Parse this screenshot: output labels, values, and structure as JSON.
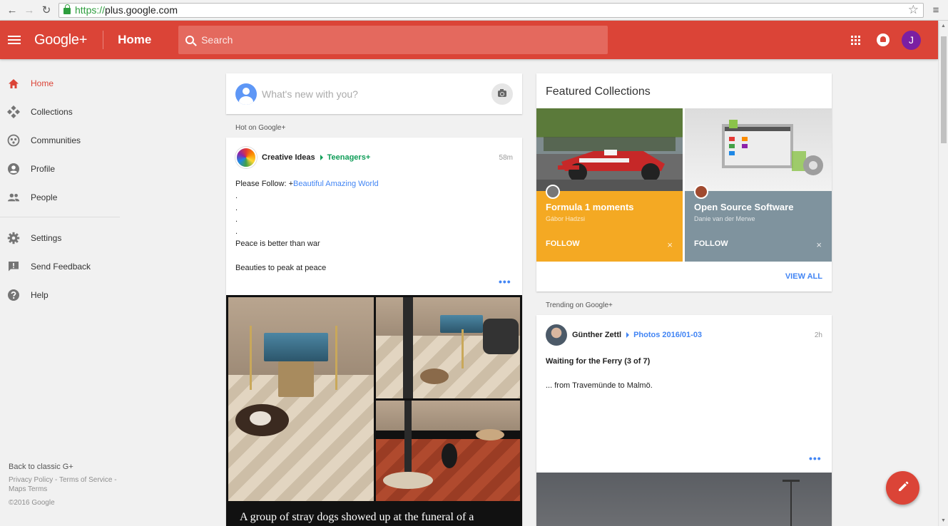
{
  "browser": {
    "url_protocol": "https://",
    "url_host": "plus.google.com",
    "icons": [
      "back-arrow-icon",
      "forward-arrow-icon",
      "reload-icon",
      "lock-icon",
      "star-icon",
      "menu-icon"
    ]
  },
  "appbar": {
    "brand": "Google+",
    "title": "Home",
    "search_placeholder": "Search",
    "avatar_letter": "J",
    "color": "#db4437"
  },
  "sidebar": {
    "items": [
      {
        "label": "Home",
        "icon": "home-icon",
        "active": true
      },
      {
        "label": "Collections",
        "icon": "collections-icon"
      },
      {
        "label": "Communities",
        "icon": "communities-icon"
      },
      {
        "label": "Profile",
        "icon": "profile-icon"
      },
      {
        "label": "People",
        "icon": "people-icon"
      },
      {
        "label": "Settings",
        "icon": "settings-icon"
      },
      {
        "label": "Send Feedback",
        "icon": "feedback-icon"
      },
      {
        "label": "Help",
        "icon": "help-icon"
      }
    ],
    "footer": {
      "back": "Back to classic G+",
      "privacy": "Privacy Policy",
      "terms": "Terms of Service",
      "maps_terms": "Maps Terms",
      "copyright": "©2016 Google"
    }
  },
  "composer": {
    "placeholder": "What's new with you?"
  },
  "hot": {
    "label": "Hot on Google+",
    "post": {
      "author": "Creative Ideas",
      "collection": "Teenagers+",
      "time": "58m",
      "line1_prefix": "Please Follow: +",
      "line1_link": "Beautiful Amazing World",
      "dot": ".",
      "line2": "Peace is better than war",
      "line3": "Beauties to peak at peace",
      "more": "•••",
      "image_caption": "A group of stray dogs showed up at the funeral of a"
    }
  },
  "featured": {
    "title": "Featured Collections",
    "collections": [
      {
        "name": "Formula 1 moments",
        "owner": "Gábor Hadzsi",
        "follow": "FOLLOW",
        "close": "×",
        "color": "#f4a923"
      },
      {
        "name": "Open Source Software",
        "owner": "Danie van der Merwe",
        "follow": "FOLLOW",
        "close": "×",
        "color": "#7f939e"
      }
    ],
    "view_all": "VIEW ALL"
  },
  "trending": {
    "label": "Trending on Google+",
    "post": {
      "author": "Günther Zettl",
      "collection": "Photos 2016/01-03",
      "time": "2h",
      "title": "Waiting for the Ferry (3 of 7)",
      "text": "... from Travemünde to Malmö.",
      "more": "•••"
    }
  },
  "fab": {
    "icon": "edit-pencil-icon"
  }
}
